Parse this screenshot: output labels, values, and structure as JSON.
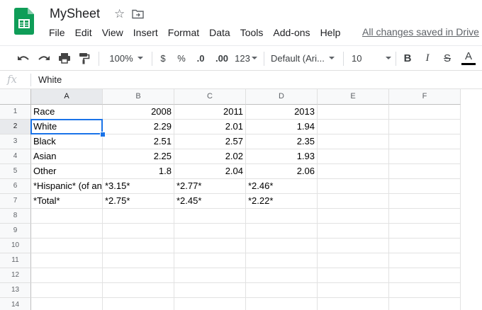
{
  "app": {
    "title": "MySheet",
    "saved_status": "All changes saved in Drive",
    "brand_color": "#0f9d58"
  },
  "menu": [
    "File",
    "Edit",
    "View",
    "Insert",
    "Format",
    "Data",
    "Tools",
    "Add-ons",
    "Help"
  ],
  "toolbar": {
    "zoom": "100%",
    "currency": "$",
    "percent": "%",
    "decrease_decimals": ".0",
    "increase_decimals": ".00",
    "more_formats": "123",
    "font": "Default (Ari...",
    "font_size": "10",
    "bold": "B",
    "italic": "I",
    "strikethrough": "S",
    "text_color": "A"
  },
  "formula_bar": {
    "fx_label": "fx",
    "value": "White"
  },
  "sheet": {
    "columns": [
      "A",
      "B",
      "C",
      "D",
      "E",
      "F"
    ],
    "rows": [
      "1",
      "2",
      "3",
      "4",
      "5",
      "6",
      "7",
      "8",
      "9",
      "10",
      "11",
      "12",
      "13",
      "14"
    ],
    "active_cell": "A2",
    "cells": [
      [
        "Race",
        "2008",
        "2011",
        "2013",
        "",
        ""
      ],
      [
        "White",
        "2.29",
        "2.01",
        "1.94",
        "",
        ""
      ],
      [
        "Black",
        "2.51",
        "2.57",
        "2.35",
        "",
        ""
      ],
      [
        "Asian",
        "2.25",
        "2.02",
        "1.93",
        "",
        ""
      ],
      [
        "Other",
        "1.8",
        "2.04",
        "2.06",
        "",
        ""
      ],
      [
        "*Hispanic* (of any race)",
        "*3.15*",
        "*2.77*",
        "*2.46*",
        "",
        ""
      ],
      [
        "*Total*",
        "*2.75*",
        "*2.45*",
        "*2.22*",
        "",
        ""
      ],
      [
        "",
        "",
        "",
        "",
        "",
        ""
      ],
      [
        "",
        "",
        "",
        "",
        "",
        ""
      ],
      [
        "",
        "",
        "",
        "",
        "",
        ""
      ],
      [
        "",
        "",
        "",
        "",
        "",
        ""
      ],
      [
        "",
        "",
        "",
        "",
        "",
        ""
      ],
      [
        "",
        "",
        "",
        "",
        "",
        ""
      ],
      [
        "",
        "",
        "",
        "",
        "",
        ""
      ]
    ]
  }
}
